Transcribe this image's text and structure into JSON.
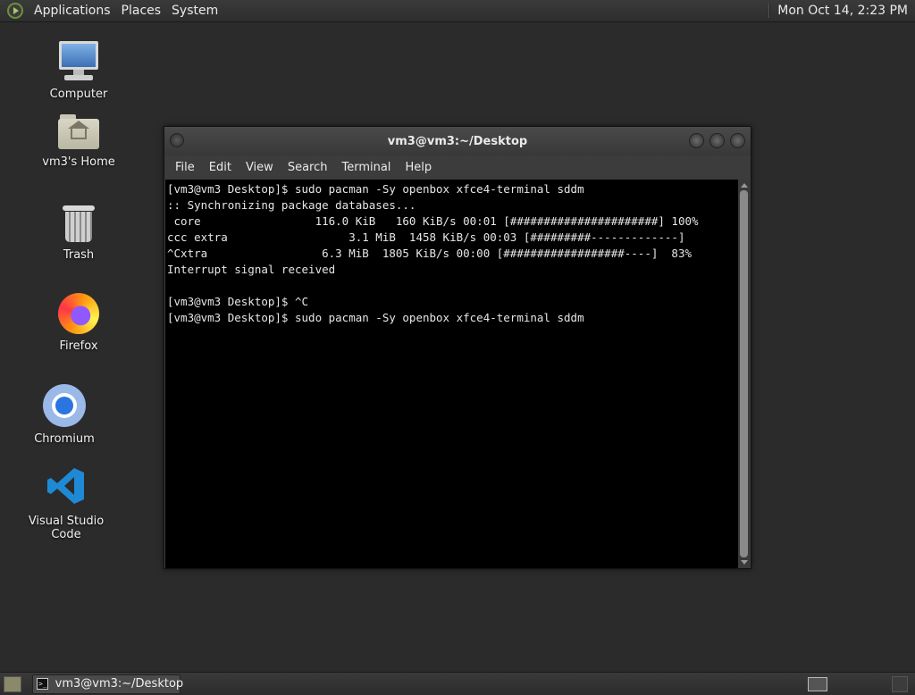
{
  "top_panel": {
    "menus": [
      "Applications",
      "Places",
      "System"
    ],
    "clock": "Mon Oct 14,  2:23 PM"
  },
  "desktop_icons": [
    {
      "label": "Computer",
      "icon": "computer-icon"
    },
    {
      "label": "vm3's Home",
      "icon": "home-folder-icon"
    },
    {
      "label": "Trash",
      "icon": "trash-icon"
    },
    {
      "label": "Firefox",
      "icon": "firefox-icon"
    },
    {
      "label": "Chromium",
      "icon": "chromium-icon"
    },
    {
      "label": "Visual Studio Code",
      "icon": "vscode-icon"
    }
  ],
  "terminal": {
    "title": "vm3@vm3:~/Desktop",
    "menu": [
      "File",
      "Edit",
      "View",
      "Search",
      "Terminal",
      "Help"
    ],
    "lines": [
      "[vm3@vm3 Desktop]$ sudo pacman -Sy openbox xfce4-terminal sddm",
      ":: Synchronizing package databases...",
      " core                 116.0 KiB   160 KiB/s 00:01 [######################] 100%",
      "ccc extra                  3.1 MiB  1458 KiB/s 00:03 [#########-------------]",
      "^Cxtra                 6.3 MiB  1805 KiB/s 00:00 [##################----]  83%",
      "Interrupt signal received",
      "",
      "[vm3@vm3 Desktop]$ ^C",
      "[vm3@vm3 Desktop]$ sudo pacman -Sy openbox xfce4-terminal sddm"
    ]
  },
  "taskbar": {
    "task_label": "vm3@vm3:~/Desktop",
    "task_icon_text": ">_"
  }
}
